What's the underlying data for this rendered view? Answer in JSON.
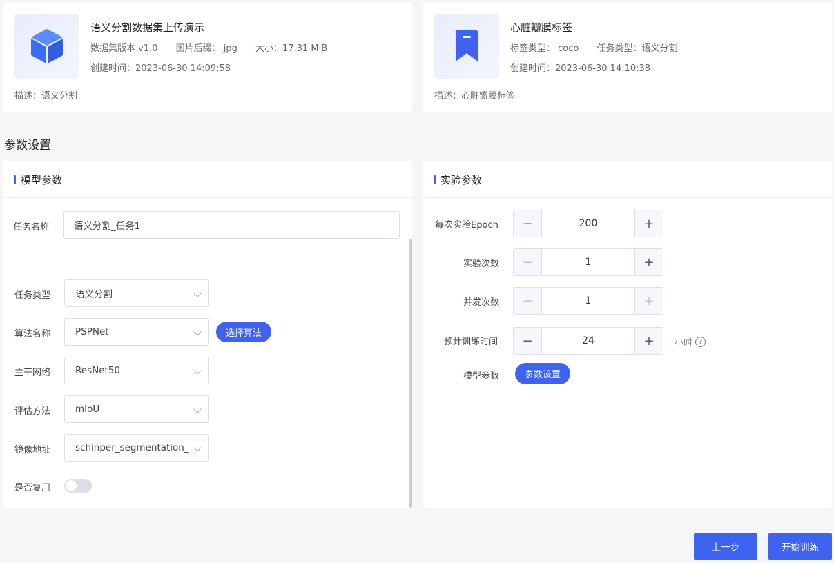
{
  "dataset": {
    "title": "语义分割数据集上传演示",
    "version": "数据集版本 v1.0",
    "suffix": "图片后缀：.jpg",
    "size": "大小：17.31 MiB",
    "created": "创建时间：2023-06-30 14:09:58",
    "desc": "描述：语义分割"
  },
  "label": {
    "title": "心脏瓣膜标签",
    "label_type": "标签类型： coco",
    "task_type": "任务类型：语义分割",
    "created": "创建时间：2023-06-30 14:10:38",
    "desc": "描述：心脏瓣膜标签"
  },
  "section_title": "参数设置",
  "model_params": {
    "title": "模型参数",
    "task_name_label": "任务名称",
    "task_name_value": "语义分割_任务1",
    "task_type_label": "任务类型",
    "task_type_value": "语义分割",
    "algo_label": "算法名称",
    "algo_value": "PSPNet",
    "algo_button": "选择算法",
    "backbone_label": "主干网络",
    "backbone_value": "ResNet50",
    "eval_label": "评估方法",
    "eval_value": "mIoU",
    "image_label": "镜像地址",
    "image_value": "schinper_segmentation_",
    "reuse_label": "是否复用",
    "reuse_on": false
  },
  "exp_params": {
    "title": "实验参数",
    "epoch_label": "每次实验Epoch",
    "epoch_value": "200",
    "runs_label": "实验次数",
    "runs_value": "1",
    "concurrency_label": "并发次数",
    "concurrency_value": "1",
    "time_label": "预计训练时间",
    "time_value": "24",
    "time_unit": "小时",
    "model_param_label": "模型参数",
    "model_param_button": "参数设置"
  },
  "footer": {
    "prev": "上一步",
    "start": "开始训练"
  },
  "colors": {
    "accent": "#3d63f0"
  },
  "icons": [
    "cube-icon",
    "bookmark-icon",
    "chevron-down-icon",
    "minus-icon",
    "plus-icon",
    "help-icon"
  ]
}
